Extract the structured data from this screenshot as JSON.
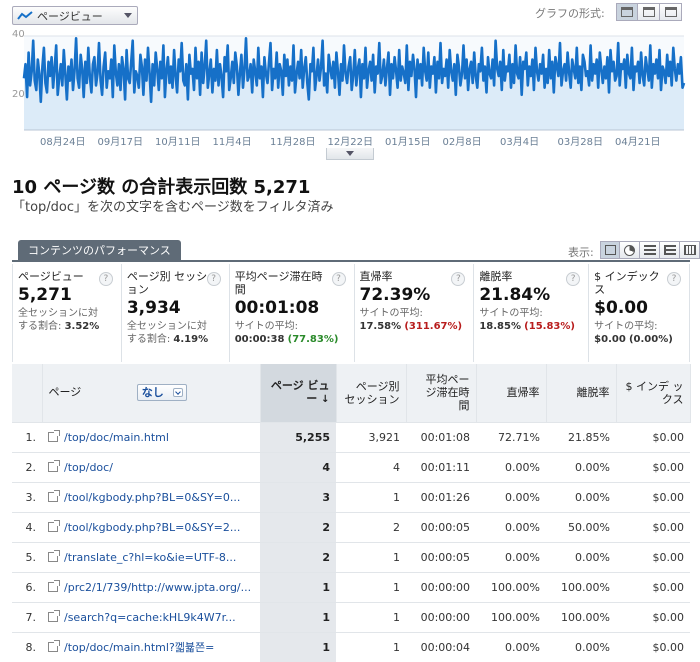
{
  "graph_toolbar": {
    "metric": "ページビュー",
    "format_label": "グラフの形式:",
    "format_buttons": [
      "line-graph-icon",
      "list-icon",
      "bar-icon"
    ]
  },
  "chart_data": {
    "type": "area",
    "series": [
      {
        "name": "ページビュー",
        "values": [
          22,
          28,
          14,
          33,
          19,
          25,
          38,
          21,
          17,
          30,
          24,
          12,
          27,
          35,
          20,
          16,
          29,
          23,
          31,
          18,
          26,
          36,
          15,
          22,
          28,
          19,
          34,
          24,
          13,
          27,
          21,
          30,
          17,
          25,
          39,
          22,
          18,
          32,
          26,
          14,
          29,
          20,
          35,
          23,
          16,
          28,
          31,
          19,
          24,
          37,
          21,
          15,
          27,
          33,
          18,
          25,
          22,
          30,
          14,
          36,
          24,
          19,
          28,
          17,
          31,
          26,
          13,
          34,
          22,
          20,
          29,
          38,
          16,
          25,
          23,
          18,
          32,
          27,
          15,
          30,
          21,
          35,
          24,
          12,
          28,
          19,
          33,
          26,
          17,
          29,
          22,
          36,
          14,
          25,
          31,
          20,
          27,
          18,
          34,
          23,
          16,
          30,
          25,
          37,
          21,
          19,
          28,
          13,
          32,
          24,
          26,
          17,
          35,
          22,
          29,
          15,
          33,
          20,
          27,
          38,
          18,
          24,
          30,
          16,
          26,
          21,
          34,
          19,
          28,
          23,
          14,
          31,
          25,
          36,
          17,
          22,
          29,
          20,
          33,
          27,
          15,
          24,
          32,
          18,
          26,
          39,
          21,
          23,
          28,
          16,
          30,
          25,
          19,
          35,
          22,
          27,
          14,
          31,
          24,
          20,
          29,
          37,
          17,
          26,
          22,
          33,
          18,
          28,
          25,
          15,
          32,
          23,
          30,
          19,
          27,
          21,
          36,
          16,
          24,
          29,
          22,
          34,
          18,
          26,
          31,
          20,
          13,
          28,
          25,
          35,
          17,
          23,
          30,
          21,
          27,
          38,
          19,
          24,
          16,
          32,
          26,
          22,
          29,
          18,
          33,
          25,
          15,
          28,
          21,
          36,
          24,
          20,
          27,
          31,
          17,
          23,
          34,
          19,
          26,
          30,
          14,
          28,
          22,
          35,
          18,
          25,
          29,
          21,
          32,
          16,
          27,
          24,
          37,
          20,
          23,
          30,
          19,
          26,
          33,
          15,
          28,
          22,
          31,
          25,
          18,
          34,
          21,
          27,
          24,
          20,
          36,
          17,
          29,
          23,
          32,
          26,
          14,
          30,
          22,
          28,
          19,
          35,
          25,
          21,
          33,
          18,
          27,
          24,
          31,
          16,
          29,
          22,
          37,
          20,
          26,
          23,
          30,
          18,
          34,
          25,
          21,
          28,
          15,
          32,
          27,
          19,
          24,
          36,
          22,
          30,
          17,
          26,
          29,
          20,
          33,
          23,
          18,
          28,
          25,
          35,
          21,
          27,
          16,
          31,
          24,
          22,
          30,
          19,
          38,
          26,
          23,
          29,
          17,
          34,
          21,
          27,
          25,
          32,
          18,
          28,
          20,
          36,
          24,
          22,
          31,
          15,
          29,
          26,
          33,
          19,
          27,
          23,
          30,
          17,
          35,
          25,
          21,
          28,
          24,
          32,
          18,
          26,
          20,
          34,
          22,
          29,
          16,
          31,
          27,
          23,
          37,
          19,
          25,
          28,
          21,
          33,
          24,
          18,
          30,
          26,
          22,
          35,
          20,
          27,
          17,
          32,
          29,
          23,
          25,
          19,
          36,
          21,
          28,
          24,
          30,
          18,
          33,
          26,
          20,
          27,
          22,
          31,
          16,
          34,
          25,
          29,
          21,
          23,
          37,
          19,
          28,
          26,
          30,
          18,
          32,
          24,
          22,
          35,
          17,
          27,
          25,
          29,
          20,
          33,
          23,
          19,
          31,
          26,
          21,
          36,
          18,
          28,
          24,
          30,
          22,
          34,
          17,
          27,
          25,
          20,
          32,
          23,
          29,
          19,
          35,
          26,
          21,
          28,
          24,
          31,
          18,
          20
        ]
      }
    ],
    "x_tick_labels": [
      "08月24日",
      "09月17日",
      "10月11日",
      "11月4日",
      "11月28日",
      "12月22日",
      "01月15日",
      "02月8日",
      "03月4日",
      "03月28日",
      "04月21日"
    ],
    "y_tick_labels": [
      "40",
      "20"
    ],
    "ylim": [
      0,
      40
    ],
    "grid": true
  },
  "summary": {
    "title": "10 ページ数 の合計表示回数 5,271",
    "filter_note": "「top/doc」を次の文字を含むページ数をフィルタ済み"
  },
  "tabs": {
    "performance": "コンテンツのパフォーマンス",
    "view_label": "表示:",
    "view_buttons": [
      "table-view-icon",
      "pie-view-icon",
      "performance-view-icon",
      "comparison-view-icon",
      "pivot-view-icon"
    ]
  },
  "scorecards": [
    {
      "label": "ページビュー",
      "value": "5,271",
      "sub1": "全セッションに対",
      "sub2": "する割合:",
      "sub_val": "3.52%",
      "sub_extra": ""
    },
    {
      "label": "ページ別 セッション",
      "value": "3,934",
      "sub1": "全セッションに対",
      "sub2": "する割合:",
      "sub_val": "4.19%",
      "sub_extra": ""
    },
    {
      "label": "平均ページ滞在時間",
      "value": "00:01:08",
      "sub1": "サイトの平均:",
      "sub2": "00:00:38",
      "sub_val": "",
      "sub_extra": "(77.83%)"
    },
    {
      "label": "直帰率",
      "value": "72.39%",
      "sub1": "サイトの平均:",
      "sub2": "17.58%",
      "sub_val": "",
      "sub_extra": "(311.67%)"
    },
    {
      "label": "離脱率",
      "value": "21.84%",
      "sub1": "サイトの平均:",
      "sub2": "18.85%",
      "sub_val": "",
      "sub_extra": "(15.83%)"
    },
    {
      "label": "$ インデックス",
      "value": "$0.00",
      "sub1": "サイトの平均:",
      "sub2": "$0.00",
      "sub_val": "",
      "sub_extra": "(0.00%)"
    }
  ],
  "table": {
    "headers": {
      "page": "ページ",
      "dimension": "なし",
      "pageviews": "ページ ビュー",
      "sessions": "ページ別 セッション",
      "avg_time": "平均ペー ジ滞在時 間",
      "bounce": "直帰率",
      "exit": "離脱率",
      "index": "$ インデ ックス"
    },
    "rows": [
      {
        "idx": "1.",
        "page": "/top/doc/main.html",
        "pv": "5,255",
        "sess": "3,921",
        "time": "00:01:08",
        "bounce": "72.71%",
        "exit": "21.85%",
        "index": "$0.00"
      },
      {
        "idx": "2.",
        "page": "/top/doc/",
        "pv": "4",
        "sess": "4",
        "time": "00:01:11",
        "bounce": "0.00%",
        "exit": "0.00%",
        "index": "$0.00"
      },
      {
        "idx": "3.",
        "page": "/tool/kgbody.php?BL=0&SY=0...",
        "pv": "3",
        "sess": "1",
        "time": "00:01:26",
        "bounce": "0.00%",
        "exit": "0.00%",
        "index": "$0.00"
      },
      {
        "idx": "4.",
        "page": "/tool/kgbody.php?BL=0&SY=2...",
        "pv": "2",
        "sess": "2",
        "time": "00:00:05",
        "bounce": "0.00%",
        "exit": "50.00%",
        "index": "$0.00"
      },
      {
        "idx": "5.",
        "page": "/translate_c?hl=ko&ie=UTF-8...",
        "pv": "2",
        "sess": "1",
        "time": "00:00:05",
        "bounce": "0.00%",
        "exit": "0.00%",
        "index": "$0.00"
      },
      {
        "idx": "6.",
        "page": "/prc2/1/739/http://www.jpta.org/...",
        "pv": "1",
        "sess": "1",
        "time": "00:00:00",
        "bounce": "100.00%",
        "exit": "100.00%",
        "index": "$0.00"
      },
      {
        "idx": "7.",
        "page": "/search?q=cache:kHL9k4W7r...",
        "pv": "1",
        "sess": "1",
        "time": "00:00:00",
        "bounce": "100.00%",
        "exit": "100.00%",
        "index": "$0.00"
      },
      {
        "idx": "8.",
        "page": "/top/doc/main.html?껣뷻쯘=",
        "pv": "1",
        "sess": "1",
        "time": "00:00:04",
        "bounce": "0.00%",
        "exit": "0.00%",
        "index": "$0.00"
      }
    ]
  },
  "colors": {
    "line": "#1670c8",
    "area": "#dcebf8",
    "tab": "#5f6b77",
    "link": "#1a4f9c",
    "positive": "#2a8a2a",
    "negative": "#b81c1c"
  }
}
